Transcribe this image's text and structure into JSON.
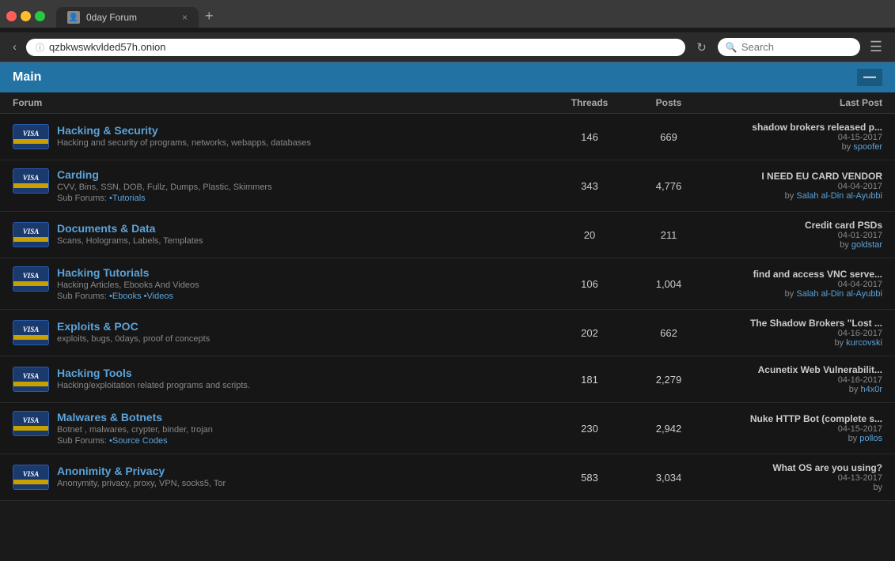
{
  "browser": {
    "tab_title": "0day Forum",
    "address": "qzbkwswkvlded57h.onion",
    "search_placeholder": "Search",
    "new_tab_label": "+",
    "close_tab_label": "×"
  },
  "page": {
    "main_title": "Main",
    "minimize_label": "—",
    "columns": {
      "forum": "Forum",
      "threads": "Threads",
      "posts": "Posts",
      "last_post": "Last Post"
    }
  },
  "forums": [
    {
      "name": "Hacking & Security",
      "description": "Hacking and security of programs, networks, webapps, databases",
      "subforums": [],
      "threads": "146",
      "posts": "669",
      "last_post_title": "shadow brokers released p...",
      "last_post_date": "04-15-2017",
      "last_post_by": "spoofer"
    },
    {
      "name": "Carding",
      "description": "CVV, Bins, SSN, DOB, Fullz, Dumps, Plastic, Skimmers",
      "subforums": [
        "Tutorials"
      ],
      "threads": "343",
      "posts": "4,776",
      "last_post_title": "I NEED EU CARD VENDOR",
      "last_post_date": "04-04-2017",
      "last_post_by": "Salah al-Din al-Ayubbi"
    },
    {
      "name": "Documents & Data",
      "description": "Scans, Holograms, Labels, Templates",
      "subforums": [],
      "threads": "20",
      "posts": "211",
      "last_post_title": "Credit card PSDs",
      "last_post_date": "04-01-2017",
      "last_post_by": "goldstar"
    },
    {
      "name": "Hacking Tutorials",
      "description": "Hacking Articles, Ebooks And Videos",
      "subforums": [
        "Ebooks",
        "Videos"
      ],
      "threads": "106",
      "posts": "1,004",
      "last_post_title": "find and access VNC serve...",
      "last_post_date": "04-04-2017",
      "last_post_by": "Salah al-Din al-Ayubbi"
    },
    {
      "name": "Exploits & POC",
      "description": "exploits, bugs, 0days, proof of concepts",
      "subforums": [],
      "threads": "202",
      "posts": "662",
      "last_post_title": "The Shadow Brokers \"Lost ...",
      "last_post_date": "04-16-2017",
      "last_post_by": "kurcovski"
    },
    {
      "name": "Hacking Tools",
      "description": "Hacking/exploitation related programs and scripts.",
      "subforums": [],
      "threads": "181",
      "posts": "2,279",
      "last_post_title": "Acunetix Web Vulnerabilit...",
      "last_post_date": "04-16-2017",
      "last_post_by": "h4x0r"
    },
    {
      "name": "Malwares & Botnets",
      "description": "Botnet , malwares, crypter, binder, trojan",
      "subforums": [
        "Source Codes"
      ],
      "threads": "230",
      "posts": "2,942",
      "last_post_title": "Nuke HTTP Bot (complete s...",
      "last_post_date": "04-15-2017",
      "last_post_by": "pollos"
    },
    {
      "name": "Anonimity & Privacy",
      "description": "Anonymity, privacy, proxy, VPN, socks5, Tor",
      "subforums": [],
      "threads": "583",
      "posts": "3,034",
      "last_post_title": "What OS are you using?",
      "last_post_date": "04-13-2017",
      "last_post_by": ""
    }
  ]
}
